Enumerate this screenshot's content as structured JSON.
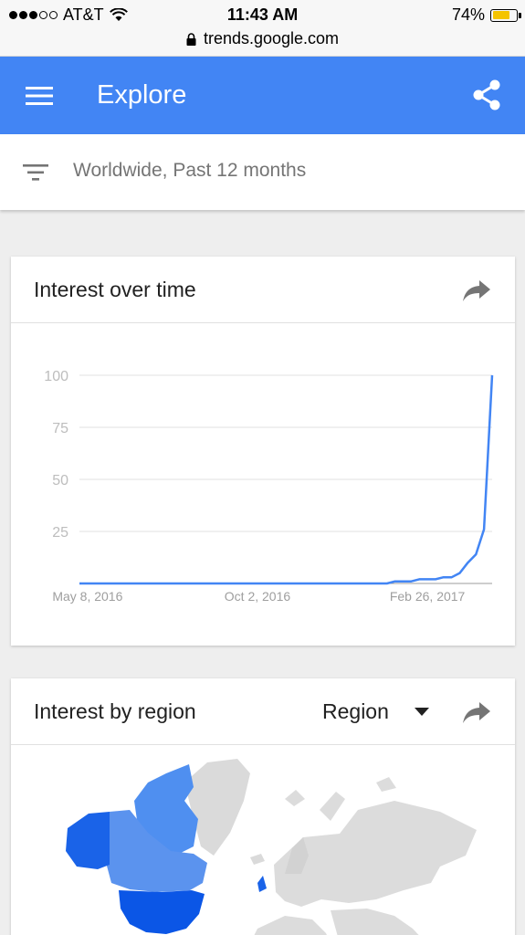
{
  "status_bar": {
    "carrier": "AT&T",
    "time": "11:43 AM",
    "battery": "74%",
    "battery_level": 0.74,
    "url": "trends.google.com"
  },
  "appbar": {
    "title": "Explore",
    "menu_icon": "menu-icon",
    "share_icon": "share-icon",
    "color": "#4285f4"
  },
  "filter": {
    "text": "Worldwide, Past 12 months",
    "icon": "filter-icon"
  },
  "interest_over_time": {
    "title": "Interest over time",
    "share_icon": "share-arrow-icon"
  },
  "chart_data": {
    "type": "line",
    "y_ticks": [
      "100",
      "75",
      "50",
      "25"
    ],
    "x_ticks": [
      "May 8, 2016",
      "Oct 2, 2016",
      "Feb 26, 2017"
    ],
    "ylim": [
      0,
      100
    ],
    "grid": true,
    "series": [
      {
        "color": "#4285f4",
        "x": [
          "2016-05-01",
          "2016-05-08",
          "2016-06-05",
          "2016-07-03",
          "2016-07-31",
          "2016-08-28",
          "2016-09-25",
          "2016-10-23",
          "2016-11-20",
          "2016-12-18",
          "2017-01-15",
          "2017-01-22",
          "2017-01-29",
          "2017-02-05",
          "2017-02-12",
          "2017-02-19",
          "2017-02-26",
          "2017-03-05",
          "2017-03-12",
          "2017-03-19",
          "2017-03-26",
          "2017-04-02",
          "2017-04-09",
          "2017-04-16",
          "2017-04-23"
        ],
        "y": [
          0,
          0,
          0,
          0,
          0,
          0,
          0,
          0,
          0,
          0,
          0,
          0,
          1,
          1,
          1,
          2,
          2,
          2,
          3,
          3,
          5,
          10,
          14,
          26,
          100
        ]
      }
    ]
  },
  "interest_by_region": {
    "title": "Interest by region",
    "select_value": "Region",
    "share_icon": "share-arrow-icon"
  }
}
